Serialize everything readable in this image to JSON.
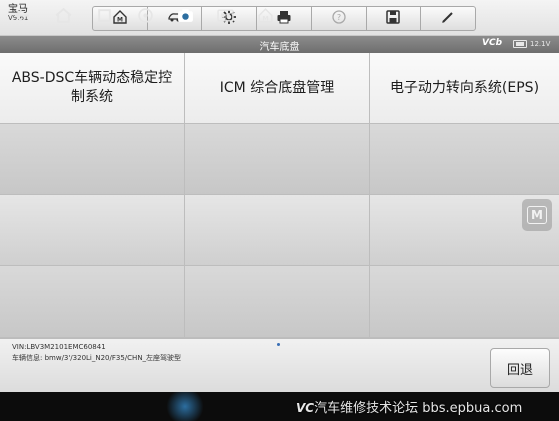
{
  "header": {
    "brand": "宝马",
    "version": "V9.61"
  },
  "toolbar": {
    "items": [
      {
        "name": "home-icon"
      },
      {
        "name": "vehicle-swap-icon"
      },
      {
        "name": "settings-icon"
      },
      {
        "name": "print-icon"
      },
      {
        "name": "help-icon"
      },
      {
        "name": "save-icon"
      },
      {
        "name": "edit-icon"
      }
    ]
  },
  "subheader": {
    "title": "汽车底盘",
    "vci": "VCb",
    "voltage": "12.1V"
  },
  "systems": [
    "ABS-DSC车辆动态稳定控制系统",
    "ICM 综合底盘管理",
    "电子动力转向系统(EPS)"
  ],
  "footer": {
    "vin": "VIN:LBV3M2101EMC60841",
    "vehicle_info": "车辆信息: bmw/3'/320Li_N20/F35/CHN_左座驾驶型",
    "back_label": "回退"
  },
  "side_button": "M",
  "navbar": {
    "watermark_prefix": "VC",
    "watermark_text": "汽车维修技术论坛 bbs.epbua.com"
  },
  "colors": {
    "subheader_bg": "#7a7a7a",
    "cell_bg": "#f3f3f3",
    "navbar_bg": "#0c0c0c",
    "accent": "#2c6ea0"
  }
}
